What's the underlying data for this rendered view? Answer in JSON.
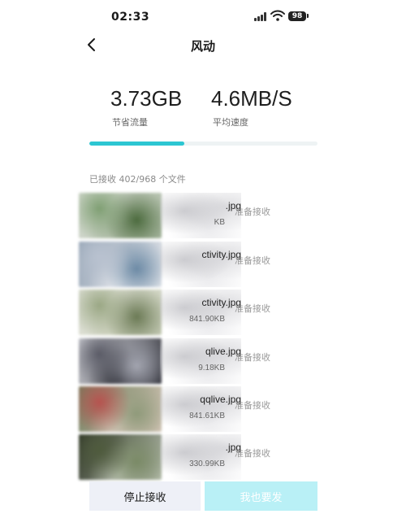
{
  "status_bar": {
    "time": "02:33",
    "battery": "98"
  },
  "nav": {
    "title": "风动"
  },
  "stats": [
    {
      "value": "3.73GB",
      "label": "节省流量"
    },
    {
      "value": "4.6MB/S",
      "label": "平均速度"
    }
  ],
  "progress": {
    "received": 402,
    "total": 968,
    "fraction": 0.415
  },
  "received_text": "已接收 402/968 个文件",
  "files": [
    {
      "name": ".jpg",
      "size": "KB",
      "status": "准备接收",
      "thumb_colors": [
        "#7f9f73",
        "#4c6b3e",
        "#a9b8a1",
        "#d8ddd4"
      ]
    },
    {
      "name": "ctivity.jpg",
      "size": "",
      "status": "准备接收",
      "thumb_colors": [
        "#b9c2d0",
        "#6c8aa5",
        "#e4e7ec",
        "#94a3b4"
      ]
    },
    {
      "name": "ctivity.jpg",
      "size": "841.90KB",
      "status": "准备接收",
      "thumb_colors": [
        "#9aa784",
        "#6b7a55",
        "#c9ceb9",
        "#e1e3da"
      ]
    },
    {
      "name": "qlive.jpg",
      "size": "9.18KB",
      "status": "准备接收",
      "thumb_colors": [
        "#5a5b66",
        "#a3a5b0",
        "#2f3038",
        "#d3d4da"
      ]
    },
    {
      "name": "qqlive.jpg",
      "size": "841.61KB",
      "status": "准备接收",
      "thumb_colors": [
        "#b7534f",
        "#8f9a7a",
        "#d6c7b9",
        "#6f7d5c"
      ]
    },
    {
      "name": ".jpg",
      "size": "330.99KB",
      "status": "准备接收",
      "thumb_colors": [
        "#4f5b3d",
        "#7a8a66",
        "#b7bfae",
        "#2e3527"
      ]
    }
  ],
  "buttons": {
    "stop": "停止接收",
    "send": "我也要发"
  },
  "colors": {
    "accent": "#2cc6d2",
    "send_bg": "#b9f0f6",
    "stop_bg": "#eef0f7"
  }
}
